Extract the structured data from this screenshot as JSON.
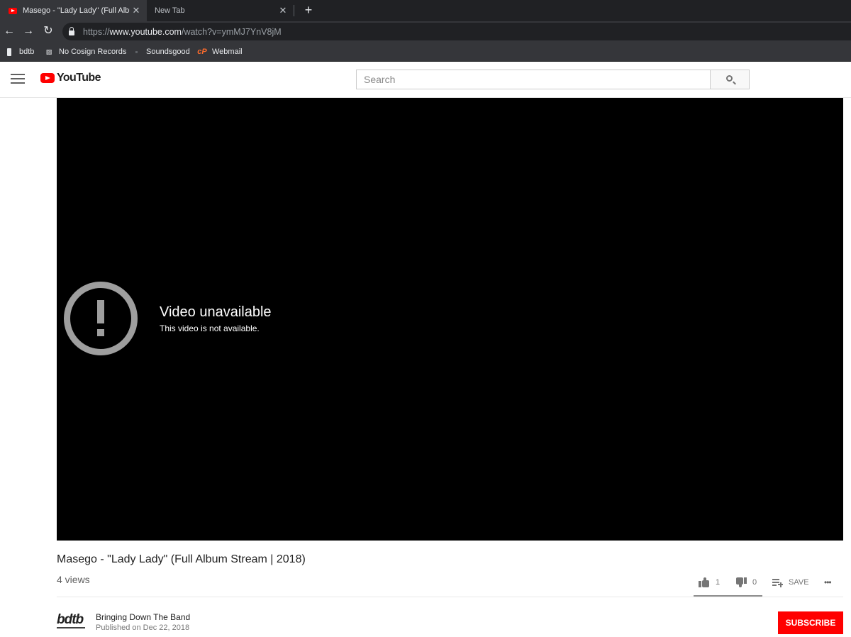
{
  "browser": {
    "tabs": [
      {
        "title": "Masego - \"Lady Lady\" (Full Albun",
        "active": true
      },
      {
        "title": "New Tab",
        "active": false
      }
    ],
    "new_tab": "+",
    "close_glyph": "✕",
    "nav": {
      "back": "←",
      "forward": "→",
      "reload": "↻"
    },
    "url": {
      "scheme": "https://",
      "host": "www.youtube.com",
      "path": "/watch?v=ymMJ7YnV8jM"
    },
    "bookmarks": [
      {
        "label": "bdtb",
        "icon": "bdtb-icon"
      },
      {
        "label": "No Cosign Records",
        "icon": "ncr-icon"
      },
      {
        "label": "Soundsgood",
        "icon": "soundsgood-icon"
      },
      {
        "label": "Webmail",
        "icon": "cpanel-icon"
      }
    ]
  },
  "masthead": {
    "logo_text": "YouTube",
    "search_placeholder": "Search"
  },
  "player": {
    "error_title": "Video unavailable",
    "error_subtitle": "This video is not available."
  },
  "video": {
    "title": "Masego - \"Lady Lady\" (Full Album Stream | 2018)",
    "views": "4 views",
    "likes": "1",
    "dislikes": "0",
    "save_label": "SAVE",
    "more_label": "•••"
  },
  "owner": {
    "logo_text": "bdtb",
    "name": "Bringing Down The Band",
    "published": "Published on Dec 22, 2018",
    "subscribe_label": "SUBSCRIBE"
  },
  "colors": {
    "brand_red": "#ff0000",
    "chrome_dark": "#202124",
    "chrome_toolbar": "#35363a"
  }
}
